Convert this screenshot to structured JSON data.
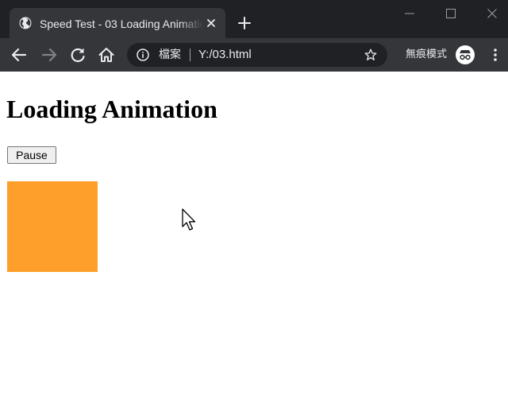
{
  "browser": {
    "tab": {
      "title": "Speed Test - 03 Loading Animation",
      "favicon": "globe-icon"
    },
    "window_controls": [
      "minimize-icon",
      "maximize-icon",
      "close-icon"
    ],
    "toolbar": {
      "omnibox": {
        "scheme_label": "檔案",
        "url": "Y:/03.html"
      },
      "incognito_label": "無痕模式"
    },
    "colors": {
      "tabstrip": "#202124",
      "toolbar": "#35363a",
      "text": "#e8eaed"
    }
  },
  "page": {
    "title": "Loading Animation",
    "pause_label": "Pause",
    "loading_square": {
      "color": "#ff9f2b"
    }
  }
}
